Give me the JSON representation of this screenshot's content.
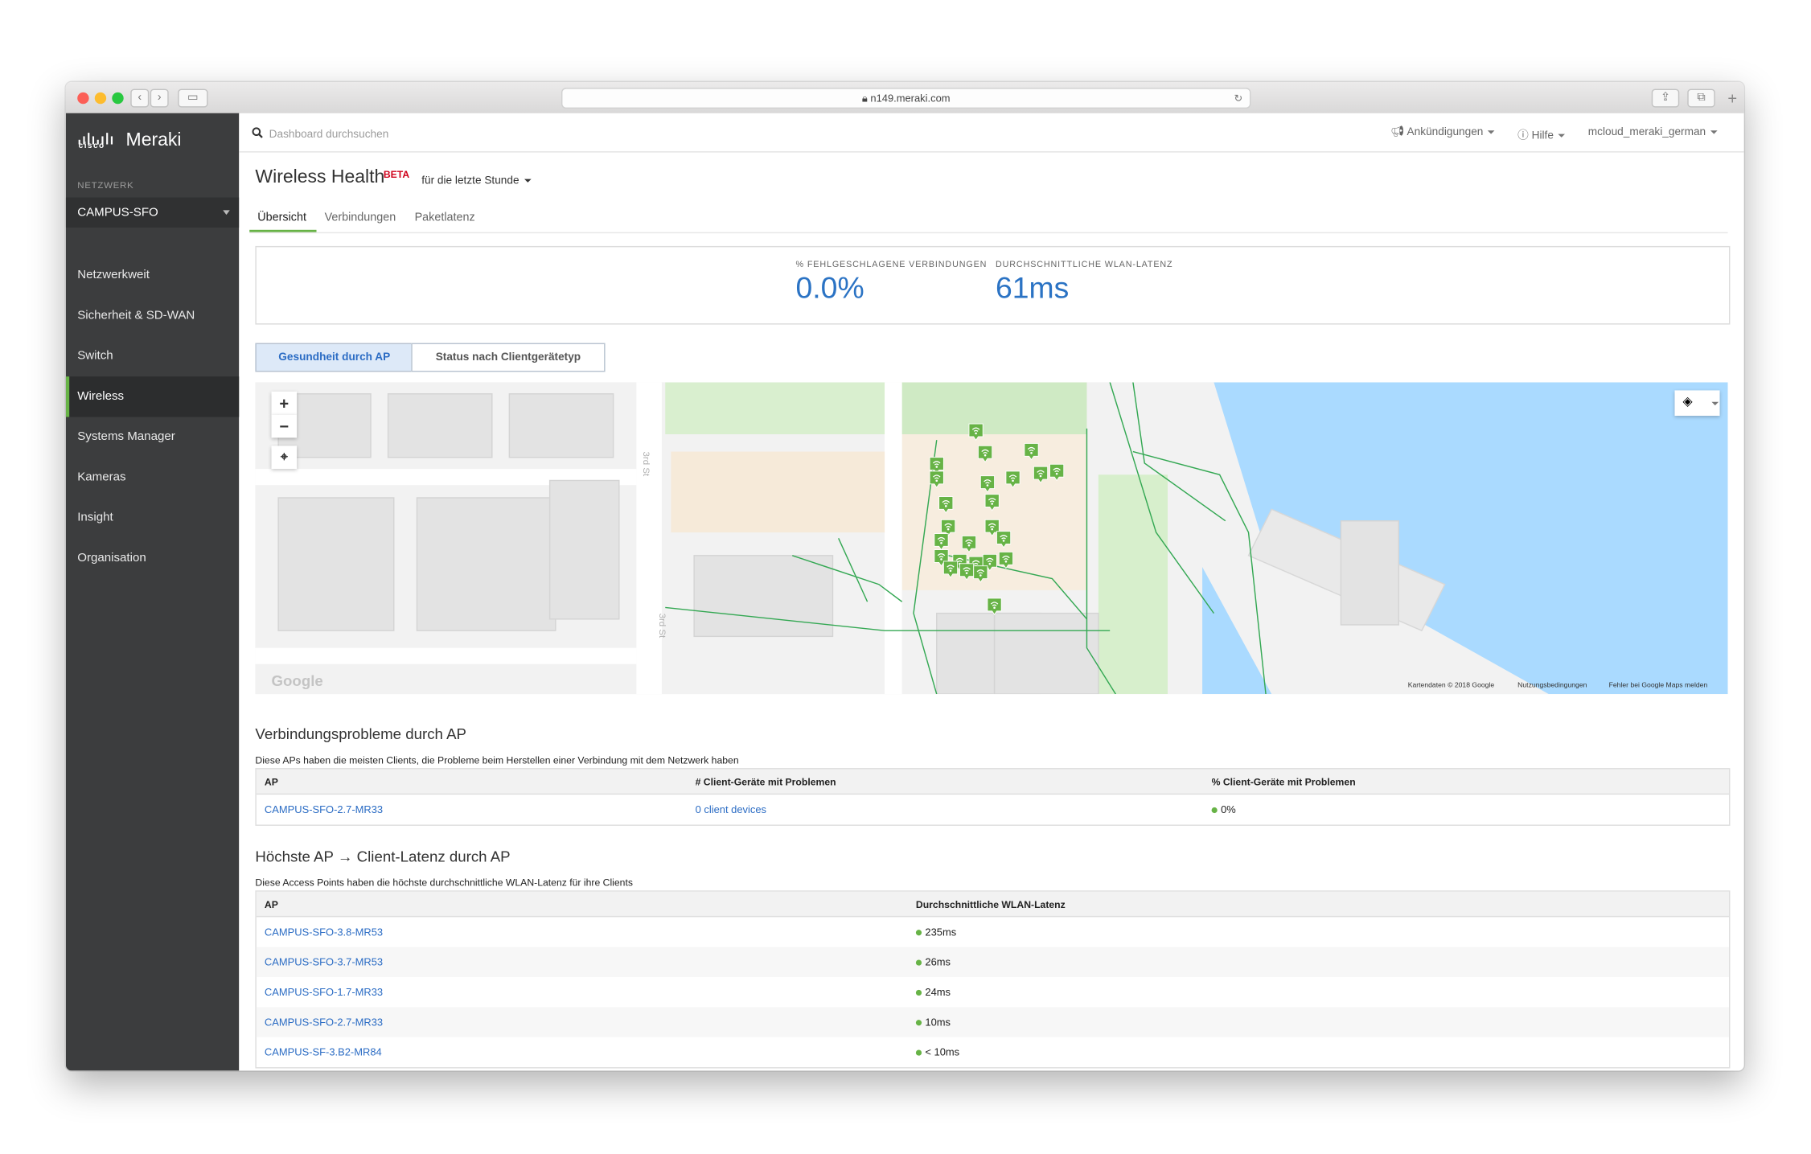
{
  "browser": {
    "url": "n149.meraki.com"
  },
  "sidebar": {
    "brand_small": "cisco",
    "brand": "Meraki",
    "network_label": "NETZWERK",
    "network_value": "CAMPUS-SFO",
    "items": [
      {
        "label": "Netzwerkweit"
      },
      {
        "label": "Sicherheit & SD-WAN"
      },
      {
        "label": "Switch"
      },
      {
        "label": "Wireless"
      },
      {
        "label": "Systems Manager"
      },
      {
        "label": "Kameras"
      },
      {
        "label": "Insight"
      },
      {
        "label": "Organisation"
      }
    ],
    "active": "Wireless"
  },
  "topbar": {
    "search_placeholder": "Dashboard durchsuchen",
    "announcements": "Ankündigungen",
    "help": "Hilfe",
    "user": "mcloud_meraki_german"
  },
  "header": {
    "title": "Wireless Health",
    "badge": "BETA",
    "time_range": "für die letzte Stunde"
  },
  "tabs": [
    {
      "label": "Übersicht"
    },
    {
      "label": "Verbindungen"
    },
    {
      "label": "Paketlatenz"
    }
  ],
  "kpis": {
    "failed_label": "% FEHLGESCHLAGENE VERBINDUNGEN",
    "failed_value": "0.0%",
    "latency_label": "DURCHSCHNITTLICHE WLAN-LATENZ",
    "latency_value": "61ms"
  },
  "toggle": {
    "by_ap": "Gesundheit durch AP",
    "by_client": "Status nach Clientgerätetyp",
    "selected": "by_ap"
  },
  "map": {
    "streets": [
      "3rd St",
      "3rd St"
    ],
    "attribution": "Kartendaten © 2018 Google",
    "terms": "Nutzungsbedingungen",
    "report": "Fehler bei Google Maps melden",
    "google": "Google",
    "marker_icon": "wifi-pin-icon",
    "marker_color": "#67b346"
  },
  "connection_issues": {
    "title": "Verbindungsprobleme durch AP",
    "subtitle": "Diese APs haben die meisten Clients, die Probleme beim Herstellen einer Verbindung mit dem Netzwerk haben",
    "columns": [
      "AP",
      "# Client-Geräte mit Problemen",
      "% Client-Geräte mit Problemen"
    ],
    "rows": [
      {
        "ap": "CAMPUS-SFO-2.7-MR33",
        "count": "0 client devices",
        "pct": "0%"
      }
    ]
  },
  "latency": {
    "title": "Höchste AP → Client-Latenz durch AP",
    "subtitle": "Diese Access Points haben die höchste durchschnittliche WLAN-Latenz für ihre Clients",
    "columns": [
      "AP",
      "Durchschnittliche WLAN-Latenz"
    ],
    "rows": [
      {
        "ap": "CAMPUS-SFO-3.8-MR53",
        "latency": "235ms"
      },
      {
        "ap": "CAMPUS-SFO-3.7-MR53",
        "latency": "26ms"
      },
      {
        "ap": "CAMPUS-SFO-1.7-MR33",
        "latency": "24ms"
      },
      {
        "ap": "CAMPUS-SFO-2.7-MR33",
        "latency": "10ms"
      },
      {
        "ap": "CAMPUS-SF-3.B2-MR84",
        "latency": "< 10ms"
      }
    ]
  },
  "colors": {
    "accent": "#67b346",
    "link": "#2b6cc4",
    "sidebar": "#3c3d3e",
    "beta": "#d0021b"
  }
}
